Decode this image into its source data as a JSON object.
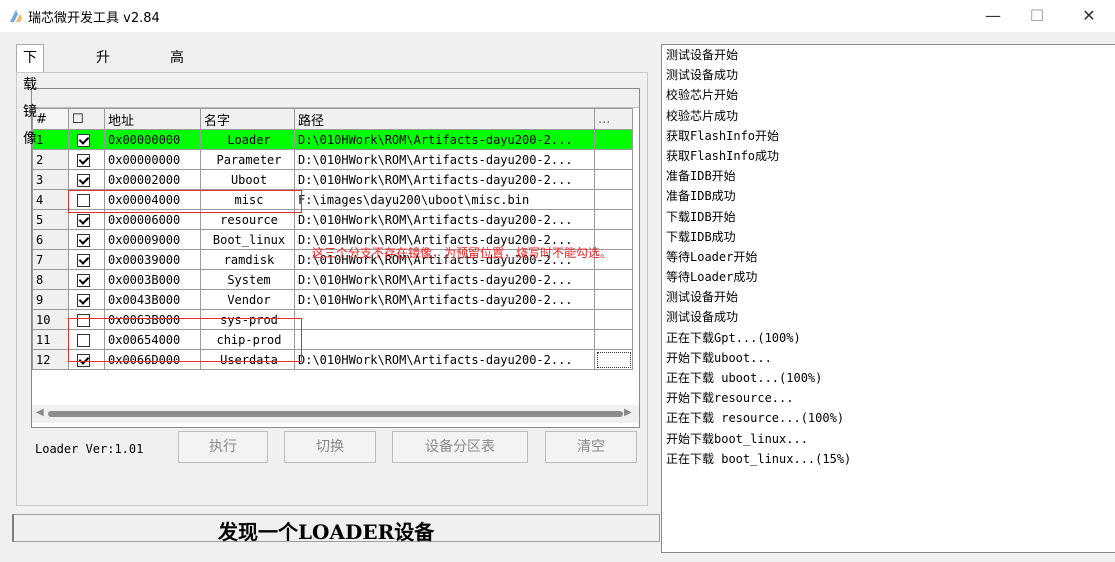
{
  "window": {
    "title": "瑞芯微开发工具 v2.84",
    "minimize": "—",
    "maximize": "☐",
    "close": "✕"
  },
  "tabs": [
    "下载镜像",
    "升级固件",
    "高级功能"
  ],
  "table": {
    "headers": {
      "index": "#",
      "check": "☐",
      "address": "地址",
      "name": "名字",
      "path": "路径",
      "more": "..."
    },
    "rows": [
      {
        "no": "1",
        "checked": true,
        "address": "0x00000000",
        "name": "Loader",
        "path": "D:\\010HWork\\ROM\\Artifacts-dayu200-2...",
        "selected": true
      },
      {
        "no": "2",
        "checked": true,
        "address": "0x00000000",
        "name": "Parameter",
        "path": "D:\\010HWork\\ROM\\Artifacts-dayu200-2..."
      },
      {
        "no": "3",
        "checked": true,
        "address": "0x00002000",
        "name": "Uboot",
        "path": "D:\\010HWork\\ROM\\Artifacts-dayu200-2..."
      },
      {
        "no": "4",
        "checked": false,
        "address": "0x00004000",
        "name": "misc",
        "path": "F:\\images\\dayu200\\uboot\\misc.bin"
      },
      {
        "no": "5",
        "checked": true,
        "address": "0x00006000",
        "name": "resource",
        "path": "D:\\010HWork\\ROM\\Artifacts-dayu200-2..."
      },
      {
        "no": "6",
        "checked": true,
        "address": "0x00009000",
        "name": "Boot_linux",
        "path": "D:\\010HWork\\ROM\\Artifacts-dayu200-2..."
      },
      {
        "no": "7",
        "checked": true,
        "address": "0x00039000",
        "name": "ramdisk",
        "path": "D:\\010HWork\\ROM\\Artifacts-dayu200-2..."
      },
      {
        "no": "8",
        "checked": true,
        "address": "0x0003B000",
        "name": "System",
        "path": "D:\\010HWork\\ROM\\Artifacts-dayu200-2..."
      },
      {
        "no": "9",
        "checked": true,
        "address": "0x0043B000",
        "name": "Vendor",
        "path": "D:\\010HWork\\ROM\\Artifacts-dayu200-2..."
      },
      {
        "no": "10",
        "checked": false,
        "address": "0x0063B000",
        "name": "sys-prod",
        "path": ""
      },
      {
        "no": "11",
        "checked": false,
        "address": "0x00654000",
        "name": "chip-prod",
        "path": ""
      },
      {
        "no": "12",
        "checked": true,
        "address": "0x0066D000",
        "name": "Userdata",
        "path": "D:\\010HWork\\ROM\\Artifacts-dayu200-2..."
      }
    ]
  },
  "annotation": "这三个分支不存在镜像，为预留位置，烧写时不能勾选。",
  "loader_version": "Loader Ver:1.01",
  "buttons": {
    "execute": "执行",
    "switch": "切换",
    "partition_table": "设备分区表",
    "clear": "清空"
  },
  "status": "发现一个LOADER设备",
  "log": [
    "测试设备开始",
    "测试设备成功",
    "校验芯片开始",
    "校验芯片成功",
    "获取FlashInfo开始",
    "获取FlashInfo成功",
    "准备IDB开始",
    "准备IDB成功",
    "下载IDB开始",
    "下载IDB成功",
    "等待Loader开始",
    "等待Loader成功",
    "测试设备开始",
    "测试设备成功",
    "正在下载Gpt...(100%)",
    "开始下载uboot...",
    "正在下载 uboot...(100%)",
    "开始下载resource...",
    "正在下载 resource...(100%)",
    "开始下载boot_linux...",
    "正在下载 boot_linux...(15%)"
  ],
  "colors": {
    "selected_row": "#00ff00",
    "annotation": "#ff2020"
  }
}
